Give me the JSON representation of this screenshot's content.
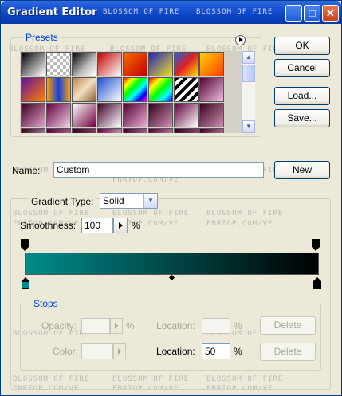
{
  "window": {
    "title": "Gradient Editor"
  },
  "watermark": {
    "line1": "BLOSSOM OF FIRE",
    "line2": "FNRTOP.COM/VE"
  },
  "presets": {
    "label": "Presets",
    "swatches": [
      [
        "linear-gradient(135deg,#000 0%,#fff 100%)",
        "repeating-conic-gradient(#bbb 0 25%,#fff 0 50%) 0 0/8px 8px",
        "linear-gradient(135deg,#000,#bbb 60%,#fff)",
        "linear-gradient(135deg,#c00000,#ffffff)",
        "linear-gradient(135deg,#ff6a00,#c00000)",
        "linear-gradient(135deg,#2020c0,#f0e020)",
        "linear-gradient(135deg,#2060e0,#e02020,#ffe000)",
        "linear-gradient(135deg,#ffd000,#ff4000)"
      ],
      [
        "linear-gradient(135deg,#6010a0,#ff8000)",
        "linear-gradient(90deg,#ffa000,#1040e0,#ffa000)",
        "linear-gradient(135deg,#c08050,#f0e0c0,#906030)",
        "linear-gradient(135deg,#2050d0,#ffffff)",
        "linear-gradient(135deg,#ff0000,#ff0,#0f0,#0ff,#00f,#f0f)",
        "linear-gradient(135deg,#ff0000,#ff0,#0f0,#0ff,#00f)",
        "repeating-linear-gradient(135deg,#000 0 4px,#fff 4px 8px)",
        "linear-gradient(135deg,#500030,#f0c0e0)"
      ],
      [
        "linear-gradient(135deg,#3a0020,#e0a0c8)",
        "linear-gradient(135deg,#600040,#f0d0e0)",
        "linear-gradient(135deg,#fff,#700040)",
        "linear-gradient(135deg,#400028,#ffffff)",
        "linear-gradient(135deg,#500030,#e8b0d0)",
        "linear-gradient(135deg,#300018,#d090b8)",
        "linear-gradient(135deg,#600038,#ffffff)",
        "linear-gradient(135deg,#400020,#c890b0)"
      ],
      [
        "linear-gradient(135deg,#300018,#f0c8e0)",
        "linear-gradient(135deg,#500030,#d8a0c0)",
        "linear-gradient(135deg,#300018,#b07090)",
        "linear-gradient(135deg,#600040,#ffffff)",
        "linear-gradient(135deg,#400028,#e0b0d0)",
        "linear-gradient(135deg,#500030,#f0d0e0)",
        "linear-gradient(135deg,#300018,#c080a8)",
        "linear-gradient(135deg,#400020,#e8c0d8)"
      ]
    ]
  },
  "buttons": {
    "ok": "OK",
    "cancel": "Cancel",
    "load": "Load...",
    "save": "Save...",
    "new": "New"
  },
  "name": {
    "label": "Name:",
    "value": "Custom"
  },
  "gradient": {
    "type_label": "Gradient Type:",
    "type_value": "Solid",
    "smoothness_label": "Smoothness:",
    "smoothness_value": "100",
    "smoothness_unit": "%",
    "start_color": "#008b8b",
    "end_color": "#000000",
    "midpoint": 0.5
  },
  "stops": {
    "label": "Stops",
    "opacity_label": "Opacity:",
    "opacity_unit": "%",
    "opacity_location_label": "Location:",
    "opacity_location_unit": "%",
    "delete_label": "Delete",
    "color_label": "Color:",
    "color_location_label": "Location:",
    "color_location_value": "50",
    "color_location_unit": "%",
    "delete2_label": "Delete"
  }
}
